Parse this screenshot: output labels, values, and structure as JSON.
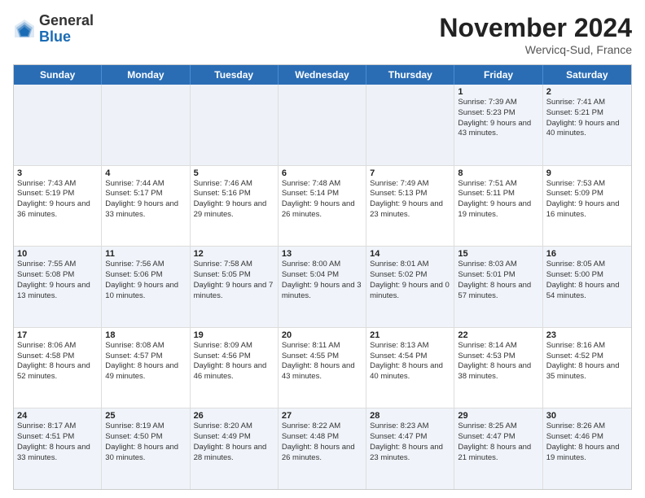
{
  "header": {
    "logo_general": "General",
    "logo_blue": "Blue",
    "month_title": "November 2024",
    "location": "Wervicq-Sud, France"
  },
  "weekdays": [
    "Sunday",
    "Monday",
    "Tuesday",
    "Wednesday",
    "Thursday",
    "Friday",
    "Saturday"
  ],
  "rows": [
    [
      {
        "day": "",
        "info": ""
      },
      {
        "day": "",
        "info": ""
      },
      {
        "day": "",
        "info": ""
      },
      {
        "day": "",
        "info": ""
      },
      {
        "day": "",
        "info": ""
      },
      {
        "day": "1",
        "info": "Sunrise: 7:39 AM\nSunset: 5:23 PM\nDaylight: 9 hours and 43 minutes."
      },
      {
        "day": "2",
        "info": "Sunrise: 7:41 AM\nSunset: 5:21 PM\nDaylight: 9 hours and 40 minutes."
      }
    ],
    [
      {
        "day": "3",
        "info": "Sunrise: 7:43 AM\nSunset: 5:19 PM\nDaylight: 9 hours and 36 minutes."
      },
      {
        "day": "4",
        "info": "Sunrise: 7:44 AM\nSunset: 5:17 PM\nDaylight: 9 hours and 33 minutes."
      },
      {
        "day": "5",
        "info": "Sunrise: 7:46 AM\nSunset: 5:16 PM\nDaylight: 9 hours and 29 minutes."
      },
      {
        "day": "6",
        "info": "Sunrise: 7:48 AM\nSunset: 5:14 PM\nDaylight: 9 hours and 26 minutes."
      },
      {
        "day": "7",
        "info": "Sunrise: 7:49 AM\nSunset: 5:13 PM\nDaylight: 9 hours and 23 minutes."
      },
      {
        "day": "8",
        "info": "Sunrise: 7:51 AM\nSunset: 5:11 PM\nDaylight: 9 hours and 19 minutes."
      },
      {
        "day": "9",
        "info": "Sunrise: 7:53 AM\nSunset: 5:09 PM\nDaylight: 9 hours and 16 minutes."
      }
    ],
    [
      {
        "day": "10",
        "info": "Sunrise: 7:55 AM\nSunset: 5:08 PM\nDaylight: 9 hours and 13 minutes."
      },
      {
        "day": "11",
        "info": "Sunrise: 7:56 AM\nSunset: 5:06 PM\nDaylight: 9 hours and 10 minutes."
      },
      {
        "day": "12",
        "info": "Sunrise: 7:58 AM\nSunset: 5:05 PM\nDaylight: 9 hours and 7 minutes."
      },
      {
        "day": "13",
        "info": "Sunrise: 8:00 AM\nSunset: 5:04 PM\nDaylight: 9 hours and 3 minutes."
      },
      {
        "day": "14",
        "info": "Sunrise: 8:01 AM\nSunset: 5:02 PM\nDaylight: 9 hours and 0 minutes."
      },
      {
        "day": "15",
        "info": "Sunrise: 8:03 AM\nSunset: 5:01 PM\nDaylight: 8 hours and 57 minutes."
      },
      {
        "day": "16",
        "info": "Sunrise: 8:05 AM\nSunset: 5:00 PM\nDaylight: 8 hours and 54 minutes."
      }
    ],
    [
      {
        "day": "17",
        "info": "Sunrise: 8:06 AM\nSunset: 4:58 PM\nDaylight: 8 hours and 52 minutes."
      },
      {
        "day": "18",
        "info": "Sunrise: 8:08 AM\nSunset: 4:57 PM\nDaylight: 8 hours and 49 minutes."
      },
      {
        "day": "19",
        "info": "Sunrise: 8:09 AM\nSunset: 4:56 PM\nDaylight: 8 hours and 46 minutes."
      },
      {
        "day": "20",
        "info": "Sunrise: 8:11 AM\nSunset: 4:55 PM\nDaylight: 8 hours and 43 minutes."
      },
      {
        "day": "21",
        "info": "Sunrise: 8:13 AM\nSunset: 4:54 PM\nDaylight: 8 hours and 40 minutes."
      },
      {
        "day": "22",
        "info": "Sunrise: 8:14 AM\nSunset: 4:53 PM\nDaylight: 8 hours and 38 minutes."
      },
      {
        "day": "23",
        "info": "Sunrise: 8:16 AM\nSunset: 4:52 PM\nDaylight: 8 hours and 35 minutes."
      }
    ],
    [
      {
        "day": "24",
        "info": "Sunrise: 8:17 AM\nSunset: 4:51 PM\nDaylight: 8 hours and 33 minutes."
      },
      {
        "day": "25",
        "info": "Sunrise: 8:19 AM\nSunset: 4:50 PM\nDaylight: 8 hours and 30 minutes."
      },
      {
        "day": "26",
        "info": "Sunrise: 8:20 AM\nSunset: 4:49 PM\nDaylight: 8 hours and 28 minutes."
      },
      {
        "day": "27",
        "info": "Sunrise: 8:22 AM\nSunset: 4:48 PM\nDaylight: 8 hours and 26 minutes."
      },
      {
        "day": "28",
        "info": "Sunrise: 8:23 AM\nSunset: 4:47 PM\nDaylight: 8 hours and 23 minutes."
      },
      {
        "day": "29",
        "info": "Sunrise: 8:25 AM\nSunset: 4:47 PM\nDaylight: 8 hours and 21 minutes."
      },
      {
        "day": "30",
        "info": "Sunrise: 8:26 AM\nSunset: 4:46 PM\nDaylight: 8 hours and 19 minutes."
      }
    ]
  ]
}
